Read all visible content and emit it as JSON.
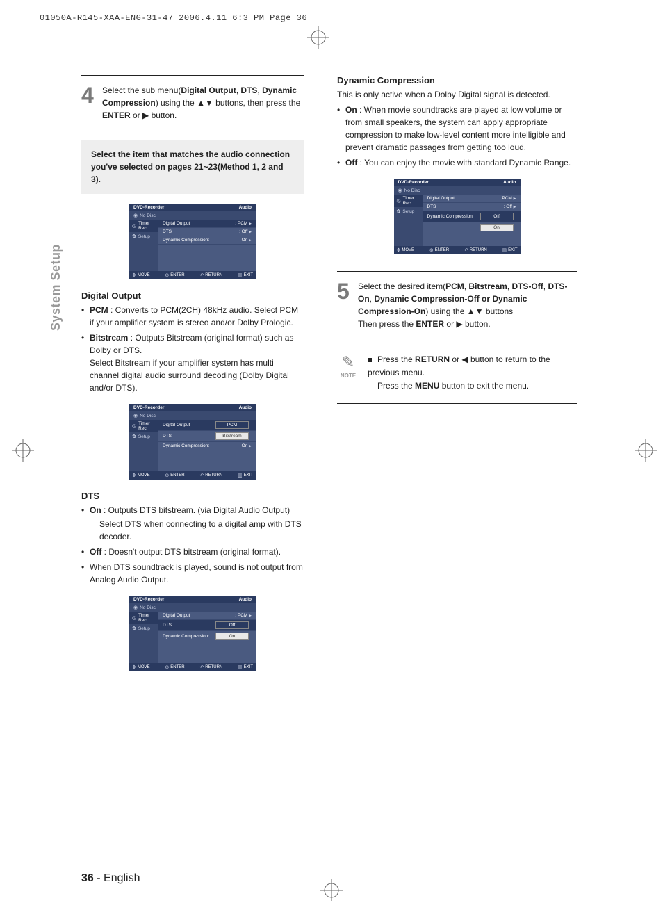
{
  "header_line": "01050A-R145-XAA-ENG-31-47  2006.4.11  6:3 PM  Page 36",
  "sidebar_label": "System Setup",
  "step4": {
    "num": "4",
    "text_a": "Select the sub menu(",
    "b1": "Digital Output",
    "c1": ", ",
    "b2": "DTS",
    "c2": ", ",
    "b3": "Dynamic Compression",
    "text_b": ") using the ",
    "glyph1": "▲▼",
    "text_c": " buttons, then press the ",
    "b4": "ENTER",
    "text_d": " or ",
    "glyph2": "▶",
    "text_e": " button."
  },
  "callout": "Select the item that matches the audio connection you've selected on pages 21~23(Method 1, 2 and 3).",
  "osd_common": {
    "title_l": "DVD-Recorder",
    "title_r": "Audio",
    "nodisc": "No Disc",
    "side_timer": "Timer Rec.",
    "side_setup": "Setup",
    "foot_move": "MOVE",
    "foot_enter": "ENTER",
    "foot_return": "RETURN",
    "foot_exit": "EXIT"
  },
  "osd1": {
    "r1l": "Digital Output",
    "r1r": ": PCM",
    "r2l": "DTS",
    "r2r": ": Off",
    "r3l": "Dynamic Compression:",
    "r3r": "On"
  },
  "digital_output": {
    "h": "Digital Output",
    "pcm_b": "PCM",
    "pcm_t": " : Converts to PCM(2CH) 48kHz audio. Select PCM if your amplifier system is stereo and/or Dolby Prologic.",
    "bit_b": "Bitstream",
    "bit_t": " : Outputs Bitstream (original format) such as Dolby or DTS.",
    "bit_t2": "Select Bitstream if your amplifier system has multi channel digital audio surround decoding (Dolby Digital and/or DTS)."
  },
  "osd2": {
    "r1l": "Digital Output",
    "d1": "PCM",
    "d2": "Bitstream",
    "r2l": "DTS",
    "r3l": "Dynamic Compression:",
    "r3r": "On"
  },
  "dts": {
    "h": "DTS",
    "on_b": "On",
    "on_t": " : Outputs DTS bitstream. (via Digital Audio Output)",
    "on_t2": "Select DTS when connecting to a digital amp with DTS decoder.",
    "off_b": "Off",
    "off_t": " : Doesn't output DTS bitstream (original format).",
    "extra": "When DTS soundtrack is played, sound is not output from Analog Audio Output."
  },
  "osd3": {
    "r1l": "Digital Output",
    "r1r": ": PCM",
    "r2l": "DTS",
    "d1": "Off",
    "d2": "On",
    "r3l": "Dynamic Compression:"
  },
  "dyn": {
    "h": "Dynamic Compression",
    "intro": "This is only active when a Dolby Digital signal is detected.",
    "on_b": "On",
    "on_t": " : When movie soundtracks are played at low volume or from small speakers, the system can apply appropriate compression to make low-level content more intelligible and prevent dramatic passages from getting too loud.",
    "off_b": "Off",
    "off_t": " : You can enjoy the movie with standard Dynamic Range."
  },
  "osd4": {
    "r1l": "Digital Output",
    "r1r": ": PCM",
    "r2l": "DTS",
    "r2r": ": Off",
    "r3l": "Dynamic Compression",
    "d1": "Off",
    "d2": "On"
  },
  "step5": {
    "num": "5",
    "text_a": "Select the desired item(",
    "b1": "PCM",
    "c1": ", ",
    "b2": "Bitstream",
    "c2": ", ",
    "b3": "DTS-Off",
    "c3": ", ",
    "b4": "DTS-On",
    "c4": ", ",
    "b5": "Dynamic Compression-Off or Dynamic Compression-On",
    "text_b": ") using the ",
    "glyph1": "▲▼",
    "text_c": " buttons",
    "text_d": "Then press the ",
    "b6": "ENTER",
    "text_e": " or ",
    "glyph2": "▶",
    "text_f": " button."
  },
  "note": {
    "label": "NOTE",
    "l1a": "Press the ",
    "l1b": "RETURN",
    "l1c": " or ",
    "l1g": "◀",
    "l1d": " button to return to the previous menu.",
    "l2a": "Press the ",
    "l2b": "MENU",
    "l2c": " button to exit the menu."
  },
  "page": {
    "num": "36",
    "sep": " - ",
    "lang": "English"
  }
}
